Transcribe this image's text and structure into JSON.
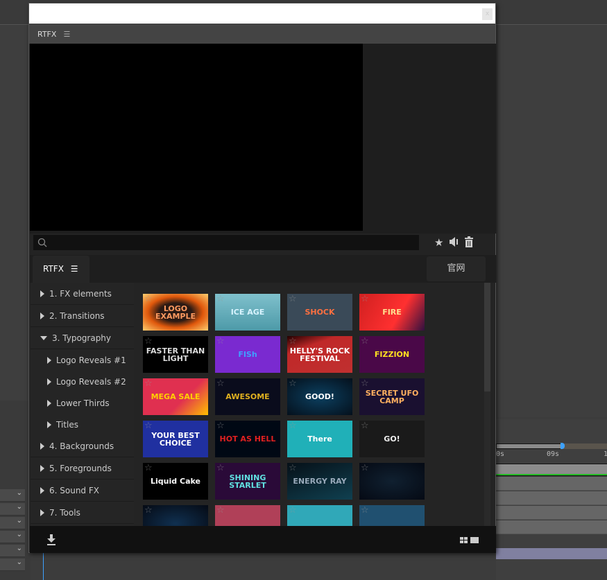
{
  "background_app": {
    "ruler_labels": [
      "0s",
      "09s",
      "1"
    ]
  },
  "window": {
    "close_label": "x",
    "panel_title": "RTFX",
    "panel_menu_icon": "hamburger-icon"
  },
  "search": {
    "placeholder": "",
    "icon": "search-icon"
  },
  "toolbar_icons": [
    "star-icon",
    "volume-icon",
    "trash-icon"
  ],
  "tabs": [
    {
      "label": "RTFX",
      "icon": "hamburger-icon",
      "active": true
    },
    {
      "label": "官网",
      "active": false
    }
  ],
  "sidebar": {
    "items": [
      {
        "label": "1. FX elements",
        "expanded": false
      },
      {
        "label": "2. Transitions",
        "expanded": false
      },
      {
        "label": "3. Typography",
        "expanded": true
      },
      {
        "label": "Logo Reveals #1",
        "sub": true
      },
      {
        "label": "Logo Reveals #2",
        "sub": true
      },
      {
        "label": "Lower Thirds",
        "sub": true
      },
      {
        "label": "Titles",
        "sub": true
      },
      {
        "label": "4. Backgrounds",
        "expanded": false
      },
      {
        "label": "5. Foregrounds",
        "expanded": false
      },
      {
        "label": "6. Sound FX",
        "expanded": false
      },
      {
        "label": "7. Tools",
        "expanded": false
      }
    ]
  },
  "thumbnails": [
    {
      "text": "LOGO EXAMPLE",
      "bg": "radial-gradient(#2a1a14 35%,#e0580c 60%,#ffd070)",
      "color": "#ff9a60"
    },
    {
      "text": "ICE AGE",
      "bg": "linear-gradient(#7fc0cc,#4d9aa8)",
      "color": "#d8f4ff"
    },
    {
      "text": "SHOCK",
      "bg": "#3a4a58",
      "color": "#ff7040"
    },
    {
      "text": "FIRE",
      "bg": "linear-gradient(120deg,#d02020,#ff3030 60%,#301040)",
      "color": "#ffe090"
    },
    {
      "text": "FASTER THAN LIGHT",
      "bg": "#000",
      "color": "#ddd"
    },
    {
      "text": "FISh",
      "bg": "#7a2ad0",
      "color": "#40a0ff"
    },
    {
      "text": "HELLY'S ROCK FESTIVAL",
      "bg": "linear-gradient(160deg,#200,#c02828 30%,#c03030)",
      "color": "#fff"
    },
    {
      "text": "FIZZION",
      "bg": "#4a0848",
      "color": "#ffe020"
    },
    {
      "text": "MEGA SALE",
      "bg": "linear-gradient(135deg,#e03050 60%,#ffc000)",
      "color": "#ffd000"
    },
    {
      "text": "AWESOME",
      "bg": "#0a0c1c",
      "color": "#e0b020"
    },
    {
      "text": "GOOD!",
      "bg": "radial-gradient(#0c4060,#04101c)",
      "color": "#fff"
    },
    {
      "text": "SECRET UFO CAMP",
      "bg": "#1a1030",
      "color": "#ffb060"
    },
    {
      "text": "YOUR BEST CHOICE",
      "bg": "#2030a0",
      "color": "#fff"
    },
    {
      "text": "HOT AS HELL",
      "bg": "#000814",
      "color": "#e02020"
    },
    {
      "text": "There",
      "bg": "#20b0b8",
      "color": "#fff"
    },
    {
      "text": "GO!",
      "bg": "#1a1a1a",
      "color": "#eee"
    },
    {
      "text": "Liquid Cake",
      "bg": "#000",
      "color": "#fff"
    },
    {
      "text": "SHINING STARLET",
      "bg": "#2a0a38",
      "color": "#60e0e0"
    },
    {
      "text": "ENERGY RAY",
      "bg": "linear-gradient(160deg,#061018,#104050)",
      "color": "#9ab"
    },
    {
      "text": "",
      "bg": "radial-gradient(#102030,#050a14)",
      "color": "#f33"
    },
    {
      "text": "",
      "bg": "radial-gradient(#103050,#050a14)",
      "color": "#fff"
    },
    {
      "text": "",
      "bg": "#b04058",
      "color": "#fff"
    },
    {
      "text": "",
      "bg": "#30a8b8",
      "color": "#fff"
    },
    {
      "text": "",
      "bg": "#205070",
      "color": "#fff"
    }
  ],
  "footer": {
    "download_icon": "download-icon",
    "view_icons": [
      "grid-view-icon",
      "list-view-icon"
    ]
  }
}
